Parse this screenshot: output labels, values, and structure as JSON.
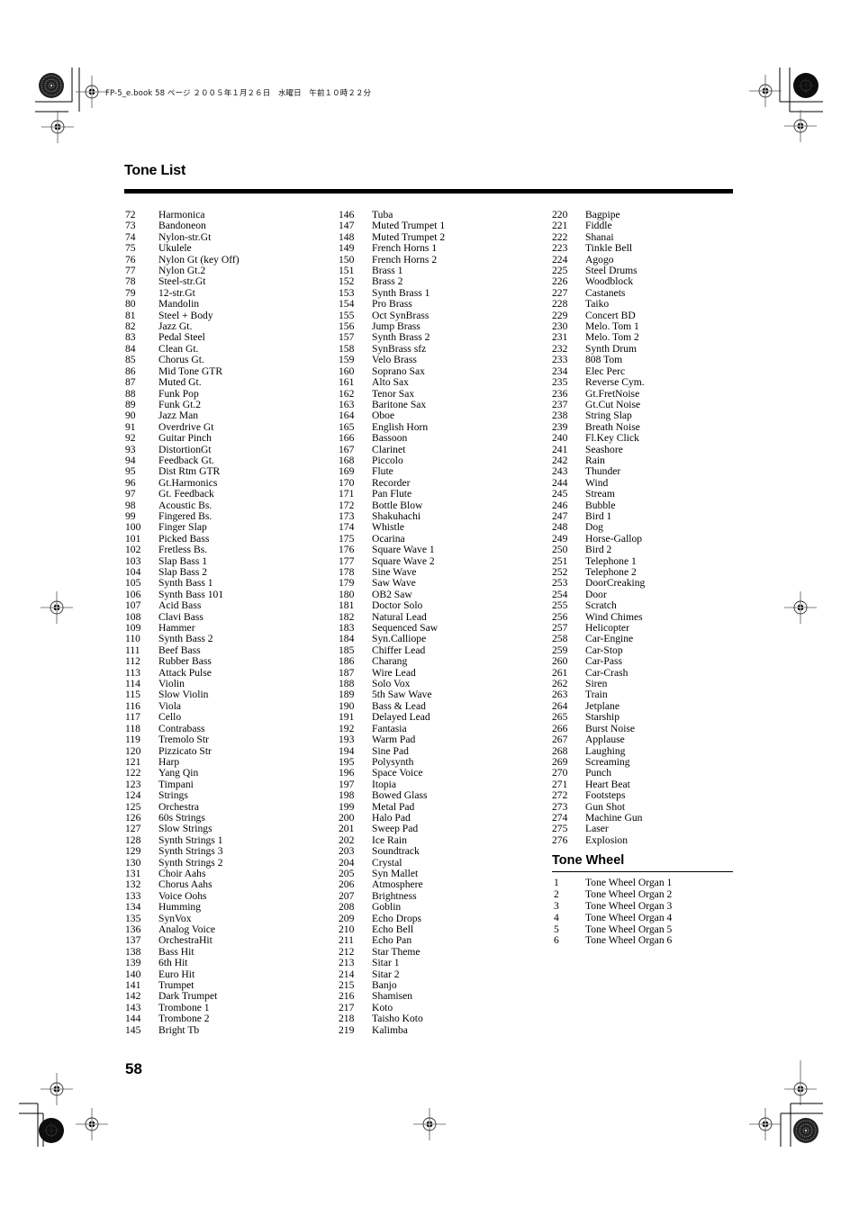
{
  "header": {
    "slug_text": "FP-5_e.book 58 ページ ２００５年１月２６日　水曜日　午前１０時２２分"
  },
  "section": {
    "title": "Tone List"
  },
  "tone_list": {
    "columns": [
      [
        {
          "num": "72",
          "name": "Harmonica"
        },
        {
          "num": "73",
          "name": "Bandoneon"
        },
        {
          "num": "74",
          "name": "Nylon-str.Gt"
        },
        {
          "num": "75",
          "name": "Ukulele"
        },
        {
          "num": "76",
          "name": "Nylon Gt (key Off)"
        },
        {
          "num": "77",
          "name": "Nylon Gt.2"
        },
        {
          "num": "78",
          "name": "Steel-str.Gt"
        },
        {
          "num": "79",
          "name": "12-str.Gt"
        },
        {
          "num": "80",
          "name": "Mandolin"
        },
        {
          "num": "81",
          "name": "Steel + Body"
        },
        {
          "num": "82",
          "name": "Jazz Gt."
        },
        {
          "num": "83",
          "name": "Pedal Steel"
        },
        {
          "num": "84",
          "name": "Clean Gt."
        },
        {
          "num": "85",
          "name": "Chorus Gt."
        },
        {
          "num": "86",
          "name": "Mid Tone GTR"
        },
        {
          "num": "87",
          "name": "Muted Gt."
        },
        {
          "num": "88",
          "name": "Funk Pop"
        },
        {
          "num": "89",
          "name": "Funk Gt.2"
        },
        {
          "num": "90",
          "name": "Jazz Man"
        },
        {
          "num": "91",
          "name": "Overdrive Gt"
        },
        {
          "num": "92",
          "name": "Guitar Pinch"
        },
        {
          "num": "93",
          "name": "DistortionGt"
        },
        {
          "num": "94",
          "name": "Feedback Gt."
        },
        {
          "num": "95",
          "name": "Dist Rtm GTR"
        },
        {
          "num": "96",
          "name": "Gt.Harmonics"
        },
        {
          "num": "97",
          "name": "Gt. Feedback"
        },
        {
          "num": "98",
          "name": "Acoustic Bs."
        },
        {
          "num": "99",
          "name": "Fingered Bs."
        },
        {
          "num": "100",
          "name": "Finger Slap"
        },
        {
          "num": "101",
          "name": "Picked Bass"
        },
        {
          "num": "102",
          "name": "Fretless Bs."
        },
        {
          "num": "103",
          "name": "Slap Bass 1"
        },
        {
          "num": "104",
          "name": "Slap Bass 2"
        },
        {
          "num": "105",
          "name": "Synth Bass 1"
        },
        {
          "num": "106",
          "name": "Synth Bass 101"
        },
        {
          "num": "107",
          "name": "Acid Bass"
        },
        {
          "num": "108",
          "name": "Clavi Bass"
        },
        {
          "num": "109",
          "name": "Hammer"
        },
        {
          "num": "110",
          "name": "Synth Bass 2"
        },
        {
          "num": "111",
          "name": "Beef Bass"
        },
        {
          "num": "112",
          "name": "Rubber Bass"
        },
        {
          "num": "113",
          "name": "Attack Pulse"
        },
        {
          "num": "114",
          "name": "Violin"
        },
        {
          "num": "115",
          "name": "Slow Violin"
        },
        {
          "num": "116",
          "name": "Viola"
        },
        {
          "num": "117",
          "name": "Cello"
        },
        {
          "num": "118",
          "name": "Contrabass"
        },
        {
          "num": "119",
          "name": "Tremolo Str"
        },
        {
          "num": "120",
          "name": "Pizzicato Str"
        },
        {
          "num": "121",
          "name": "Harp"
        },
        {
          "num": "122",
          "name": "Yang Qin"
        },
        {
          "num": "123",
          "name": "Timpani"
        },
        {
          "num": "124",
          "name": "Strings"
        },
        {
          "num": "125",
          "name": "Orchestra"
        },
        {
          "num": "126",
          "name": "60s Strings"
        },
        {
          "num": "127",
          "name": "Slow Strings"
        },
        {
          "num": "128",
          "name": "Synth Strings 1"
        },
        {
          "num": "129",
          "name": "Synth Strings 3"
        },
        {
          "num": "130",
          "name": "Synth Strings 2"
        },
        {
          "num": "131",
          "name": "Choir Aahs"
        },
        {
          "num": "132",
          "name": "Chorus Aahs"
        },
        {
          "num": "133",
          "name": "Voice Oohs"
        },
        {
          "num": "134",
          "name": "Humming"
        },
        {
          "num": "135",
          "name": "SynVox"
        },
        {
          "num": "136",
          "name": "Analog Voice"
        },
        {
          "num": "137",
          "name": "OrchestraHit"
        },
        {
          "num": "138",
          "name": "Bass Hit"
        },
        {
          "num": "139",
          "name": "6th Hit"
        },
        {
          "num": "140",
          "name": "Euro Hit"
        },
        {
          "num": "141",
          "name": "Trumpet"
        },
        {
          "num": "142",
          "name": "Dark Trumpet"
        },
        {
          "num": "143",
          "name": "Trombone 1"
        },
        {
          "num": "144",
          "name": "Trombone 2"
        },
        {
          "num": "145",
          "name": "Bright Tb"
        }
      ],
      [
        {
          "num": "146",
          "name": "Tuba"
        },
        {
          "num": "147",
          "name": "Muted Trumpet 1"
        },
        {
          "num": "148",
          "name": "Muted Trumpet 2"
        },
        {
          "num": "149",
          "name": "French Horns 1"
        },
        {
          "num": "150",
          "name": "French Horns 2"
        },
        {
          "num": "151",
          "name": "Brass 1"
        },
        {
          "num": "152",
          "name": "Brass 2"
        },
        {
          "num": "153",
          "name": "Synth Brass 1"
        },
        {
          "num": "154",
          "name": "Pro Brass"
        },
        {
          "num": "155",
          "name": "Oct SynBrass"
        },
        {
          "num": "156",
          "name": "Jump Brass"
        },
        {
          "num": "157",
          "name": "Synth Brass 2"
        },
        {
          "num": "158",
          "name": "SynBrass sfz"
        },
        {
          "num": "159",
          "name": "Velo Brass"
        },
        {
          "num": "160",
          "name": "Soprano Sax"
        },
        {
          "num": "161",
          "name": "Alto Sax"
        },
        {
          "num": "162",
          "name": "Tenor Sax"
        },
        {
          "num": "163",
          "name": "Baritone Sax"
        },
        {
          "num": "164",
          "name": "Oboe"
        },
        {
          "num": "165",
          "name": "English Horn"
        },
        {
          "num": "166",
          "name": "Bassoon"
        },
        {
          "num": "167",
          "name": "Clarinet"
        },
        {
          "num": "168",
          "name": "Piccolo"
        },
        {
          "num": "169",
          "name": "Flute"
        },
        {
          "num": "170",
          "name": "Recorder"
        },
        {
          "num": "171",
          "name": "Pan Flute"
        },
        {
          "num": "172",
          "name": "Bottle Blow"
        },
        {
          "num": "173",
          "name": "Shakuhachi"
        },
        {
          "num": "174",
          "name": "Whistle"
        },
        {
          "num": "175",
          "name": "Ocarina"
        },
        {
          "num": "176",
          "name": "Square Wave 1"
        },
        {
          "num": "177",
          "name": "Square Wave 2"
        },
        {
          "num": "178",
          "name": "Sine Wave"
        },
        {
          "num": "179",
          "name": "Saw Wave"
        },
        {
          "num": "180",
          "name": "OB2 Saw"
        },
        {
          "num": "181",
          "name": "Doctor Solo"
        },
        {
          "num": "182",
          "name": "Natural Lead"
        },
        {
          "num": "183",
          "name": "Sequenced Saw"
        },
        {
          "num": "184",
          "name": "Syn.Calliope"
        },
        {
          "num": "185",
          "name": "Chiffer Lead"
        },
        {
          "num": "186",
          "name": "Charang"
        },
        {
          "num": "187",
          "name": "Wire Lead"
        },
        {
          "num": "188",
          "name": "Solo Vox"
        },
        {
          "num": "189",
          "name": "5th Saw Wave"
        },
        {
          "num": "190",
          "name": "Bass & Lead"
        },
        {
          "num": "191",
          "name": "Delayed Lead"
        },
        {
          "num": "192",
          "name": "Fantasia"
        },
        {
          "num": "193",
          "name": "Warm Pad"
        },
        {
          "num": "194",
          "name": "Sine Pad"
        },
        {
          "num": "195",
          "name": "Polysynth"
        },
        {
          "num": "196",
          "name": "Space Voice"
        },
        {
          "num": "197",
          "name": "Itopia"
        },
        {
          "num": "198",
          "name": "Bowed Glass"
        },
        {
          "num": "199",
          "name": "Metal Pad"
        },
        {
          "num": "200",
          "name": "Halo Pad"
        },
        {
          "num": "201",
          "name": "Sweep Pad"
        },
        {
          "num": "202",
          "name": "Ice Rain"
        },
        {
          "num": "203",
          "name": "Soundtrack"
        },
        {
          "num": "204",
          "name": "Crystal"
        },
        {
          "num": "205",
          "name": "Syn Mallet"
        },
        {
          "num": "206",
          "name": "Atmosphere"
        },
        {
          "num": "207",
          "name": "Brightness"
        },
        {
          "num": "208",
          "name": "Goblin"
        },
        {
          "num": "209",
          "name": "Echo Drops"
        },
        {
          "num": "210",
          "name": "Echo Bell"
        },
        {
          "num": "211",
          "name": "Echo Pan"
        },
        {
          "num": "212",
          "name": "Star Theme"
        },
        {
          "num": "213",
          "name": "Sitar 1"
        },
        {
          "num": "214",
          "name": "Sitar 2"
        },
        {
          "num": "215",
          "name": "Banjo"
        },
        {
          "num": "216",
          "name": "Shamisen"
        },
        {
          "num": "217",
          "name": "Koto"
        },
        {
          "num": "218",
          "name": "Taisho Koto"
        },
        {
          "num": "219",
          "name": "Kalimba"
        }
      ],
      [
        {
          "num": "220",
          "name": "Bagpipe"
        },
        {
          "num": "221",
          "name": "Fiddle"
        },
        {
          "num": "222",
          "name": "Shanai"
        },
        {
          "num": "223",
          "name": "Tinkle Bell"
        },
        {
          "num": "224",
          "name": "Agogo"
        },
        {
          "num": "225",
          "name": "Steel Drums"
        },
        {
          "num": "226",
          "name": "Woodblock"
        },
        {
          "num": "227",
          "name": "Castanets"
        },
        {
          "num": "228",
          "name": "Taiko"
        },
        {
          "num": "229",
          "name": "Concert BD"
        },
        {
          "num": "230",
          "name": "Melo. Tom 1"
        },
        {
          "num": "231",
          "name": "Melo. Tom 2"
        },
        {
          "num": "232",
          "name": "Synth Drum"
        },
        {
          "num": "233",
          "name": "808 Tom"
        },
        {
          "num": "234",
          "name": "Elec Perc"
        },
        {
          "num": "235",
          "name": "Reverse Cym."
        },
        {
          "num": "236",
          "name": "Gt.FretNoise"
        },
        {
          "num": "237",
          "name": "Gt.Cut Noise"
        },
        {
          "num": "238",
          "name": "String Slap"
        },
        {
          "num": "239",
          "name": "Breath Noise"
        },
        {
          "num": "240",
          "name": "Fl.Key Click"
        },
        {
          "num": "241",
          "name": "Seashore"
        },
        {
          "num": "242",
          "name": "Rain"
        },
        {
          "num": "243",
          "name": "Thunder"
        },
        {
          "num": "244",
          "name": "Wind"
        },
        {
          "num": "245",
          "name": "Stream"
        },
        {
          "num": "246",
          "name": "Bubble"
        },
        {
          "num": "247",
          "name": "Bird 1"
        },
        {
          "num": "248",
          "name": "Dog"
        },
        {
          "num": "249",
          "name": "Horse-Gallop"
        },
        {
          "num": "250",
          "name": "Bird 2"
        },
        {
          "num": "251",
          "name": "Telephone 1"
        },
        {
          "num": "252",
          "name": "Telephone 2"
        },
        {
          "num": "253",
          "name": "DoorCreaking"
        },
        {
          "num": "254",
          "name": "Door"
        },
        {
          "num": "255",
          "name": "Scratch"
        },
        {
          "num": "256",
          "name": "Wind Chimes"
        },
        {
          "num": "257",
          "name": "Helicopter"
        },
        {
          "num": "258",
          "name": "Car-Engine"
        },
        {
          "num": "259",
          "name": "Car-Stop"
        },
        {
          "num": "260",
          "name": "Car-Pass"
        },
        {
          "num": "261",
          "name": "Car-Crash"
        },
        {
          "num": "262",
          "name": "Siren"
        },
        {
          "num": "263",
          "name": "Train"
        },
        {
          "num": "264",
          "name": "Jetplane"
        },
        {
          "num": "265",
          "name": "Starship"
        },
        {
          "num": "266",
          "name": "Burst Noise"
        },
        {
          "num": "267",
          "name": "Applause"
        },
        {
          "num": "268",
          "name": "Laughing"
        },
        {
          "num": "269",
          "name": "Screaming"
        },
        {
          "num": "270",
          "name": "Punch"
        },
        {
          "num": "271",
          "name": "Heart Beat"
        },
        {
          "num": "272",
          "name": "Footsteps"
        },
        {
          "num": "273",
          "name": "Gun Shot"
        },
        {
          "num": "274",
          "name": "Machine Gun"
        },
        {
          "num": "275",
          "name": "Laser"
        },
        {
          "num": "276",
          "name": "Explosion"
        }
      ]
    ]
  },
  "tone_wheel": {
    "title": "Tone Wheel",
    "items": [
      {
        "num": "1",
        "name": "Tone Wheel Organ 1"
      },
      {
        "num": "2",
        "name": "Tone Wheel Organ 2"
      },
      {
        "num": "3",
        "name": "Tone Wheel Organ 3"
      },
      {
        "num": "4",
        "name": "Tone Wheel Organ 4"
      },
      {
        "num": "5",
        "name": "Tone Wheel Organ 5"
      },
      {
        "num": "6",
        "name": "Tone Wheel Organ 6"
      }
    ]
  },
  "footer": {
    "page_number": "58"
  }
}
